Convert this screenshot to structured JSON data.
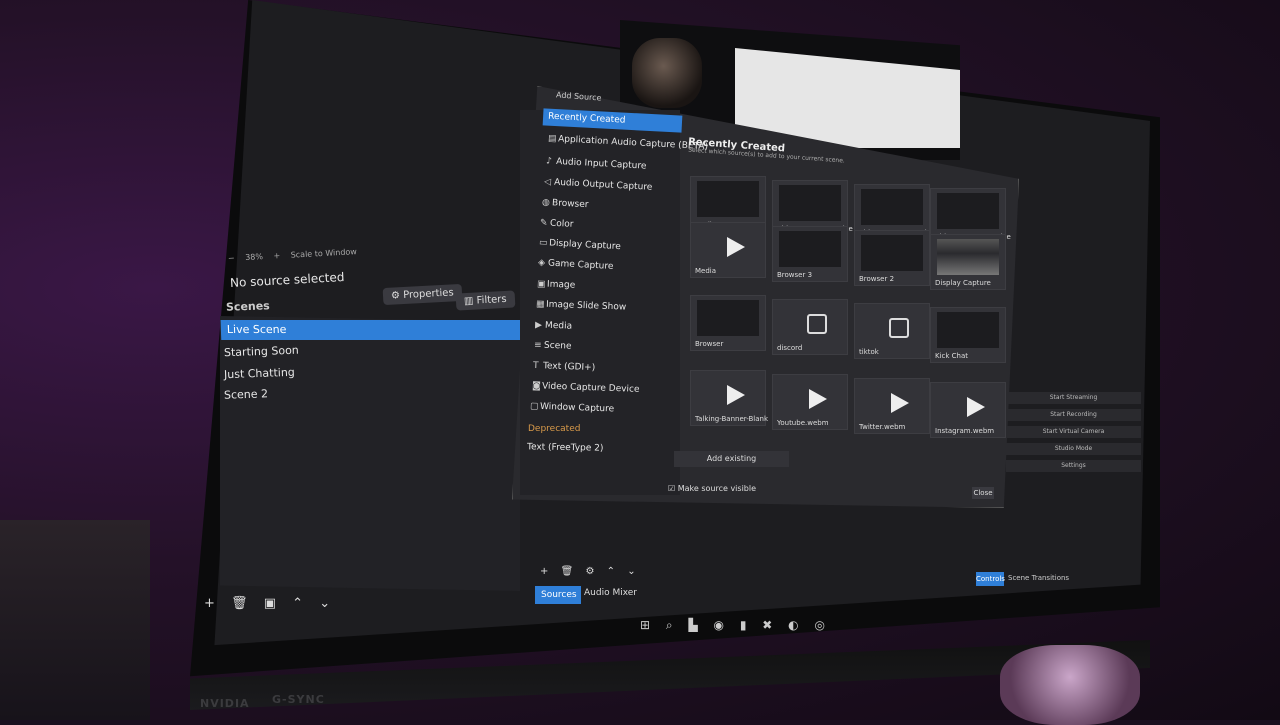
{
  "obs": {
    "zoom": "38%",
    "scale_to_window": "Scale to Window",
    "no_source": "No source selected",
    "properties_label": "Properties",
    "filters_label": "Filters",
    "scenes_header": "Scenes",
    "scenes": [
      "Live Scene",
      "Starting Soon",
      "Just Chatting",
      "Scene 2"
    ],
    "tab_sources": "Sources",
    "tab_audio_mixer": "Audio Mixer",
    "controls_tab": "Controls",
    "scene_transitions": "Scene Transitions",
    "controls": [
      "Start Streaming",
      "Start Recording",
      "Start Virtual Camera",
      "Studio Mode",
      "Settings"
    ]
  },
  "dialog": {
    "title": "Add Source",
    "selected_type": "Recently Created",
    "source_types": [
      "Application Audio Capture (BETA)",
      "Audio Input Capture",
      "Audio Output Capture",
      "Browser",
      "Color",
      "Display Capture",
      "Game Capture",
      "Image",
      "Image Slide Show",
      "Media",
      "Scene",
      "Text (GDI+)",
      "Video Capture Device",
      "Window Capture"
    ],
    "deprecated_label": "Deprecated",
    "deprecated_items": [
      "Text (FreeType 2)"
    ],
    "right_title": "Recently Created",
    "right_subtitle": "Select which source(s) to add to your current scene.",
    "tiles": [
      {
        "label": "Media 2",
        "kind": "dark"
      },
      {
        "label": "Video Capture Device 2",
        "kind": "dark"
      },
      {
        "label": "Video Capture Device 3",
        "kind": "dark"
      },
      {
        "label": "Video Capture Device",
        "kind": "dark"
      },
      {
        "label": "Media",
        "kind": "play"
      },
      {
        "label": "Browser 3",
        "kind": "dark"
      },
      {
        "label": "Browser 2",
        "kind": "dark"
      },
      {
        "label": "Display Capture",
        "kind": "screen"
      },
      {
        "label": "Browser",
        "kind": "dark"
      },
      {
        "label": "discord",
        "kind": "image"
      },
      {
        "label": "tiktok",
        "kind": "image"
      },
      {
        "label": "Kick Chat",
        "kind": "dark"
      },
      {
        "label": "Talking-Banner-Blank",
        "kind": "play"
      },
      {
        "label": "Youtube.webm",
        "kind": "play"
      },
      {
        "label": "Twitter.webm",
        "kind": "play"
      },
      {
        "label": "Instagram.webm",
        "kind": "play"
      }
    ],
    "add_existing": "Add existing",
    "make_visible": "Make source visible",
    "close": "Close"
  },
  "bezel": {
    "brand_1": "NVIDIA",
    "brand_2": "G-SYNC"
  }
}
